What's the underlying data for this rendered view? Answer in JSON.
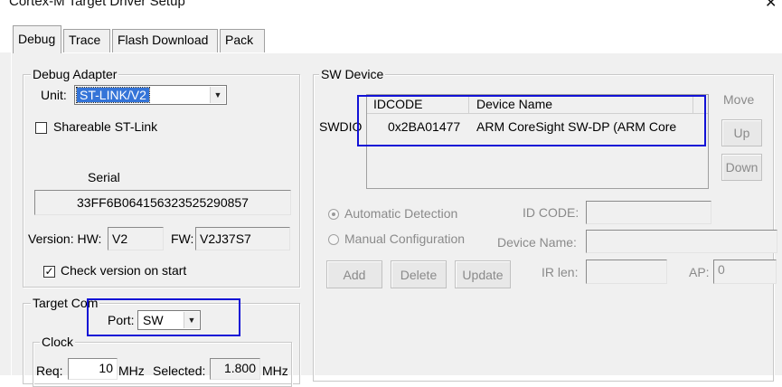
{
  "window": {
    "title": "Cortex-M Target Driver Setup",
    "close_glyph": "✕"
  },
  "tabs": [
    "Debug",
    "Trace",
    "Flash Download",
    "Pack"
  ],
  "debug_adapter": {
    "group_label": "Debug Adapter",
    "unit_label": "Unit:",
    "unit_value": "ST-LINK/V2",
    "shareable_label": "Shareable ST-Link",
    "shareable_checked": false,
    "serial_label": "Serial",
    "serial_value": "33FF6B064156323525290857",
    "version_label": "Version: HW:",
    "hw_value": "V2",
    "fw_label": "FW:",
    "fw_value": "V2J37S7",
    "check_version_label": "Check version on start",
    "check_version_checked": true
  },
  "target_com": {
    "group_label": "Target Com",
    "port_label": "Port:",
    "port_value": "SW"
  },
  "clock": {
    "group_label": "Clock",
    "req_label": "Req:",
    "req_value": "10",
    "req_unit": "MHz",
    "selected_label": "Selected:",
    "selected_value": "1.800",
    "selected_unit": "MHz"
  },
  "sw_device": {
    "group_label": "SW Device",
    "row_label": "SWDIO",
    "columns": [
      "IDCODE",
      "Device Name"
    ],
    "rows": [
      {
        "idcode": "0x2BA01477",
        "device_name": "ARM CoreSight SW-DP (ARM Core"
      }
    ],
    "move_label": "Move",
    "up_label": "Up",
    "down_label": "Down",
    "auto_detect_label": "Automatic Detection",
    "manual_config_label": "Manual Configuration",
    "id_code_label": "ID CODE:",
    "device_name_label": "Device Name:",
    "add_label": "Add",
    "delete_label": "Delete",
    "update_label": "Update",
    "ir_len_label": "IR len:",
    "ap_label": "AP:",
    "ap_value": "0"
  },
  "colors": {
    "highlight": "#1212d6",
    "selection": "#3474d8"
  }
}
